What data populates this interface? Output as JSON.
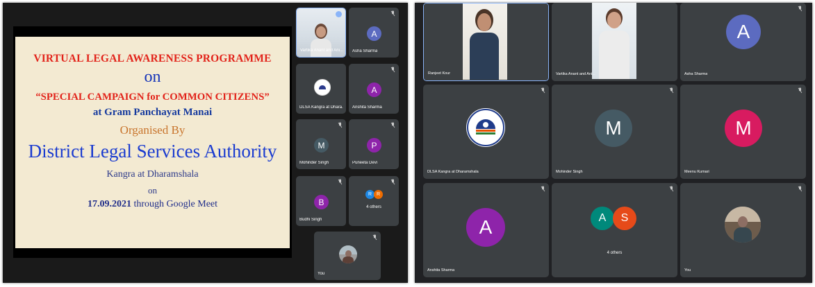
{
  "slide": {
    "line1": "VIRTUAL LEGAL AWARENESS PROGRAMME",
    "line2": "on",
    "line3": "“SPECIAL CAMPAIGN for COMMON CITIZENS”",
    "line4": "at Gram Panchayat Manai",
    "line5": "Organised By",
    "line6": "District Legal Services Authority",
    "line7": "Kangra at Dharamshala",
    "line8": "on",
    "line9_date": "17.09.2021",
    "line9_rest": " through Google Meet"
  },
  "left_panel": {
    "tiles": [
      {
        "name": "Vartika Anant and Ani...",
        "type": "video"
      },
      {
        "name": "Asha Sharma",
        "initial": "A",
        "color": "#5c6bc0"
      },
      {
        "name": "DLSA Kangra at Dhara...",
        "type": "logo"
      },
      {
        "name": "Anshita Sharma",
        "initial": "A",
        "color": "#8e24aa"
      },
      {
        "name": "Mohinder Singh",
        "initial": "M",
        "color": "#455a64"
      },
      {
        "name": "Puneeta Devi",
        "initial": "P",
        "color": "#8e24aa"
      },
      {
        "name": "Budhi Singh",
        "initial": "B",
        "color": "#8e24aa"
      },
      {
        "name": "4 others",
        "initial1": "R",
        "initial2": "R",
        "color1": "#1e88e5",
        "color2": "#ef6c00"
      },
      {
        "name": "You",
        "type": "video"
      }
    ]
  },
  "right_panel": {
    "tiles": [
      {
        "name": "Ranjeet Kour",
        "type": "video"
      },
      {
        "name": "Vartika Anant and Ani...",
        "type": "video"
      },
      {
        "name": "Asha Sharma",
        "initial": "A",
        "color": "#5c6bc0"
      },
      {
        "name": "DLSA Kangra at Dharamshala",
        "type": "logo"
      },
      {
        "name": "Mohinder Singh",
        "initial": "M",
        "color": "#455a64"
      },
      {
        "name": "Meenu Kumari",
        "initial": "M",
        "color": "#d81b60"
      },
      {
        "name": "Anshita Sharma",
        "initial": "A",
        "color": "#8e24aa"
      },
      {
        "name": "4 others",
        "initial1": "A",
        "initial2": "S",
        "color1": "#00897b",
        "color2": "#e64a19"
      },
      {
        "name": "You",
        "type": "video"
      }
    ]
  }
}
